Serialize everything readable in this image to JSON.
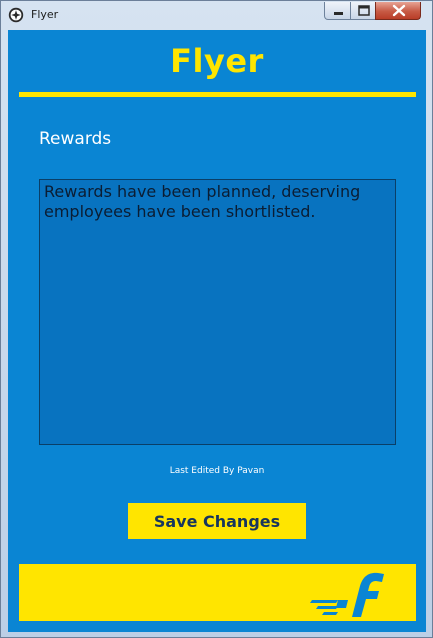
{
  "window": {
    "title": "Flyer",
    "icon": "app-logo-icon",
    "controls": [
      "minimize-icon",
      "maximize-icon",
      "close-icon"
    ]
  },
  "header": {
    "brand": "Flyer"
  },
  "form": {
    "label": "Rewards",
    "notes_text": "Rewards have been planned, deserving employees have been shortlisted.",
    "last_edited": "Last Edited By Pavan",
    "save_label": "Save Changes"
  },
  "footer": {
    "logo_icon": "flipkart-f-logo-icon"
  },
  "colors": {
    "background": "#0a85d3",
    "accent": "#ffe500",
    "button_text": "#17355e",
    "textbox": "#0873c0"
  }
}
